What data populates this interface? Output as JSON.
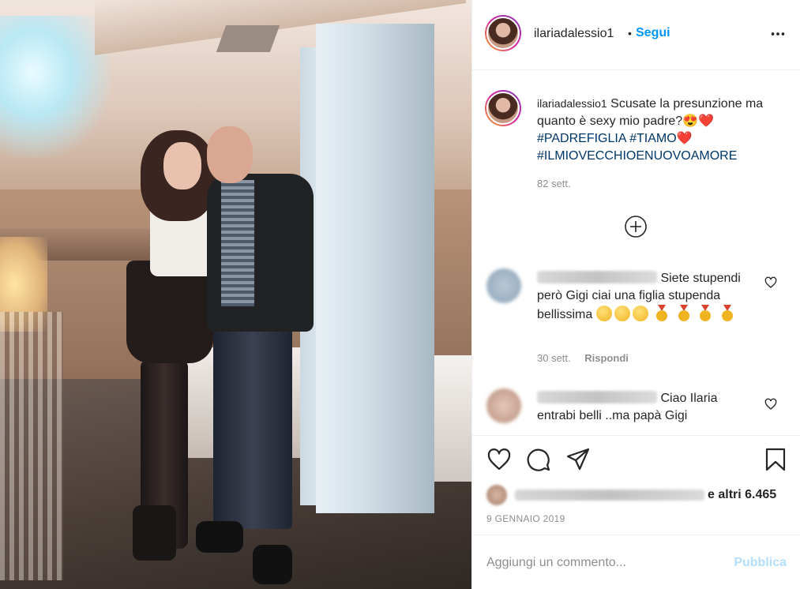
{
  "post": {
    "username": "ilariadalessio1",
    "separator": "•",
    "follow_label": "Segui",
    "more_icon": "more-horizontal-icon"
  },
  "caption": {
    "username": "ilariadalessio1",
    "text_part1": "Scusate la presunzione ma quanto è sexy mio padre?",
    "emoji_1": "😍",
    "emoji_2": "❤️",
    "hashtag_1": "#PADREFIGLIA",
    "hashtag_2": "#TIAMO",
    "emoji_3": "❤️",
    "hashtag_3": "#ILMIOVECCHIOENUOVOAMORE",
    "time": "82 sett."
  },
  "comments": [
    {
      "username_hidden": "robertopinoxxxxx",
      "text": "Siete stupendi però Gigi ciai una figlia stupenda bellissima",
      "time": "30 sett.",
      "reply_label": "Rispondi"
    },
    {
      "username_hidden": "robertofaxxxxx",
      "text": "Ciao Ilaria entrabi belli ..ma papà Gigi"
    }
  ],
  "actions": {
    "like_icon": "heart-icon",
    "comment_icon": "comment-icon",
    "share_icon": "share-icon",
    "save_icon": "bookmark-icon"
  },
  "likes": {
    "others_label": "e altri 6.465"
  },
  "date": "9 GENNAIO 2019",
  "add_comment": {
    "placeholder": "Aggiungi un commento...",
    "publish_label": "Pubblica"
  },
  "colors": {
    "link_blue": "#0095f6",
    "hashtag": "#00376b",
    "muted": "#8e8e8e",
    "publish_disabled": "#b2dffc"
  }
}
